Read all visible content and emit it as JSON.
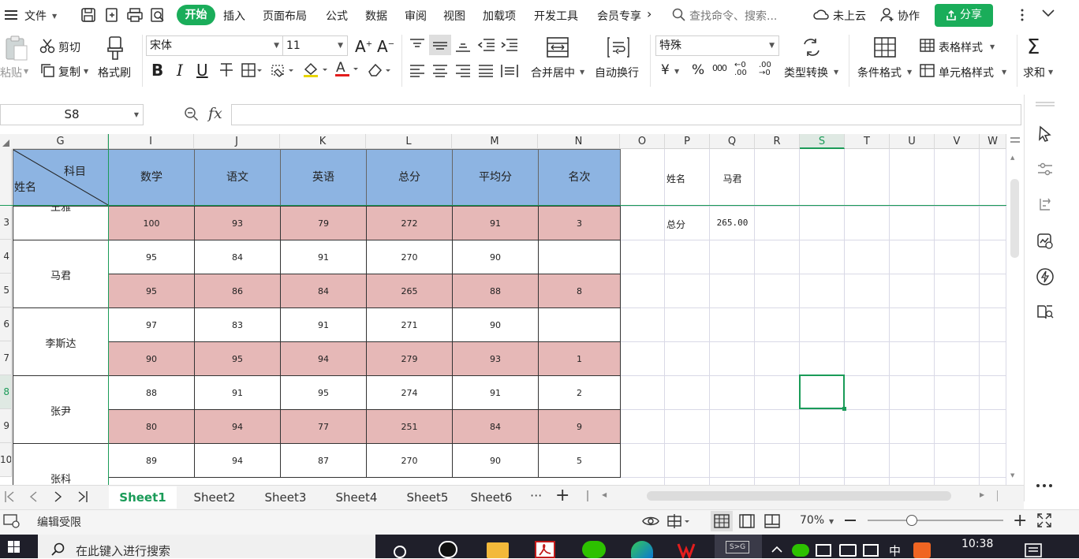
{
  "menubar": {
    "file": "文件",
    "tabs": [
      "开始",
      "插入",
      "页面布局",
      "公式",
      "数据",
      "审阅",
      "视图",
      "加载项",
      "开发工具",
      "会员专享"
    ],
    "more": "›",
    "search_placeholder": "查找命令、搜索...",
    "cloud": "未上云",
    "collab": "协作",
    "share": "分享"
  },
  "ribbon": {
    "paste": "粘贴",
    "cut": "剪切",
    "copy": "复制",
    "format_painter": "格式刷",
    "font_name": "宋体",
    "font_size": "11",
    "bold": "B",
    "italic": "I",
    "underline": "U",
    "merge_center": "合并居中",
    "wrap": "自动换行",
    "number_format": "特殊",
    "currency": "¥",
    "percent": "%",
    "thousands": "000",
    "inc_decimal": "←0 .00",
    "dec_decimal": ".00 →0",
    "type_convert": "类型转换",
    "cond_format": "条件格式",
    "table_style": "表格样式",
    "cell_style": "单元格样式",
    "sum": "求和"
  },
  "formulabar": {
    "namebox": "S8",
    "fx": "fx",
    "formula": ""
  },
  "grid": {
    "columns": [
      "G",
      "I",
      "J",
      "K",
      "L",
      "M",
      "N",
      "O",
      "P",
      "Q",
      "R",
      "S",
      "T",
      "U",
      "V",
      "W"
    ],
    "selected_column": "S",
    "header": {
      "diag_top": "科目",
      "diag_bottom": "姓名",
      "subjects": [
        "数学",
        "语文",
        "英语",
        "总分",
        "平均分",
        "名次"
      ]
    },
    "row_numbers": [
      "3",
      "4",
      "5",
      "6",
      "7",
      "8",
      "9",
      "10"
    ],
    "selected_row": "8",
    "names": [
      "王雅",
      "马君",
      "李斯达",
      "张尹",
      "张科"
    ],
    "rows": [
      [
        "100",
        "93",
        "79",
        "272",
        "91",
        "3"
      ],
      [
        "95",
        "84",
        "91",
        "270",
        "90",
        ""
      ],
      [
        "95",
        "86",
        "84",
        "265",
        "88",
        "8"
      ],
      [
        "97",
        "83",
        "91",
        "271",
        "90",
        ""
      ],
      [
        "90",
        "95",
        "94",
        "279",
        "93",
        "1"
      ],
      [
        "88",
        "91",
        "95",
        "274",
        "91",
        "2"
      ],
      [
        "80",
        "94",
        "77",
        "251",
        "84",
        "9"
      ],
      [
        "89",
        "94",
        "87",
        "270",
        "90",
        "5"
      ]
    ],
    "lookup": {
      "name_label": "姓名",
      "name_value": "马君",
      "total_label": "总分",
      "total_value": "265.00"
    }
  },
  "sheets": [
    "Sheet1",
    "Sheet2",
    "Sheet3",
    "Sheet4",
    "Sheet5",
    "Sheet6"
  ],
  "active_sheet": "Sheet1",
  "sheet_more": "···",
  "sheet_add": "+",
  "status": {
    "mode": "编辑受限",
    "zoom": "70%"
  },
  "taskbar": {
    "search_placeholder": "在此键入进行搜索",
    "ime": "中",
    "time": "10:38"
  },
  "colors": {
    "accent": "#1aad5a",
    "header_blue": "#8db4e2",
    "row_pink": "#e6b8b7"
  }
}
